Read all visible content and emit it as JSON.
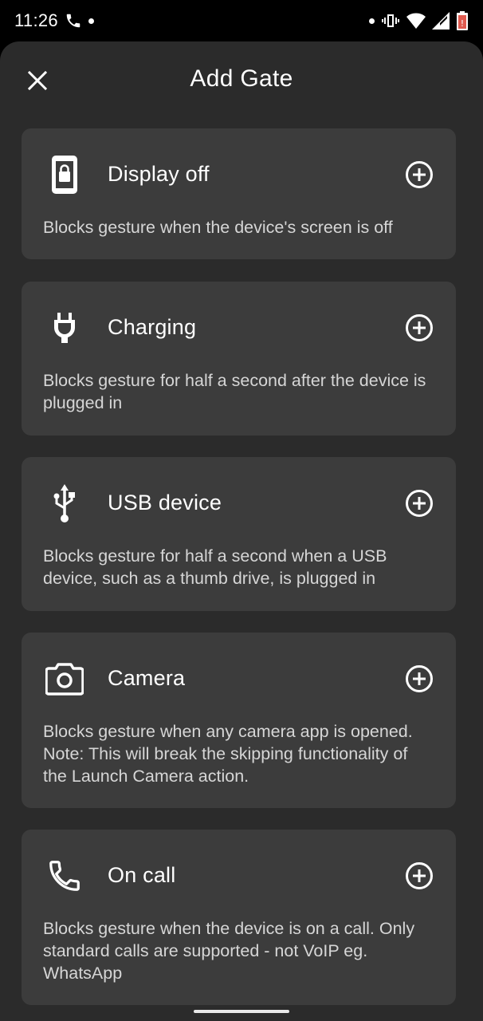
{
  "status": {
    "time": "11:26"
  },
  "header": {
    "title": "Add Gate"
  },
  "gates": [
    {
      "icon": "phone-lock-icon",
      "title": "Display off",
      "description": "Blocks gesture when the device's screen is off"
    },
    {
      "icon": "power-plug-icon",
      "title": "Charging",
      "description": "Blocks gesture for half a second after the device is plugged in"
    },
    {
      "icon": "usb-icon",
      "title": "USB device",
      "description": "Blocks gesture for half a second when a USB device, such as a thumb drive, is plugged in"
    },
    {
      "icon": "camera-icon",
      "title": "Camera",
      "description": "Blocks gesture when any camera app is opened. Note: This will break the skipping functionality of the Launch Camera action."
    },
    {
      "icon": "phone-call-icon",
      "title": "On call",
      "description": "Blocks gesture when the device is on a call. Only standard calls are supported - not VoIP eg. WhatsApp"
    }
  ],
  "colors": {
    "background": "#2b2b2b",
    "card": "#3c3c3c",
    "text_primary": "#ffffff",
    "text_secondary": "#d6d6d6"
  }
}
